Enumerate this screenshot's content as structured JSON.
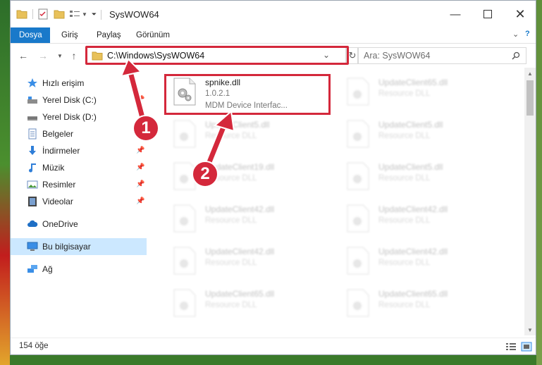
{
  "window": {
    "title": "SysWOW64"
  },
  "ribbon": {
    "tabs": [
      "Dosya",
      "Giriş",
      "Paylaş",
      "Görünüm"
    ]
  },
  "address": {
    "path": "C:\\Windows\\SysWOW64"
  },
  "search": {
    "placeholder": "Ara: SysWOW64"
  },
  "sidebar": {
    "items": [
      {
        "label": "Hızlı erişim",
        "icon": "star-icon"
      },
      {
        "label": "Yerel Disk (C:)",
        "icon": "drive-icon"
      },
      {
        "label": "Yerel Disk (D:)",
        "icon": "drive-icon"
      },
      {
        "label": "Belgeler",
        "icon": "document-icon"
      },
      {
        "label": "İndirmeler",
        "icon": "download-icon"
      },
      {
        "label": "Müzik",
        "icon": "music-icon"
      },
      {
        "label": "Resimler",
        "icon": "pictures-icon"
      },
      {
        "label": "Videolar",
        "icon": "video-icon"
      },
      {
        "label": "OneDrive",
        "icon": "cloud-icon"
      },
      {
        "label": "Bu bilgisayar",
        "icon": "computer-icon"
      },
      {
        "label": "Ağ",
        "icon": "network-icon"
      }
    ]
  },
  "files": {
    "highlighted": {
      "name": "spnike.dll",
      "version": "1.0.2.1",
      "desc": "MDM Device Interfac..."
    },
    "items": [
      {
        "name": "UpdateClient65.dll",
        "desc": "Resource DLL"
      },
      {
        "name": "UpdateClient5.dll",
        "desc": "Resource DLL"
      },
      {
        "name": "UpdateClient5.dll",
        "desc": "Resource DLL"
      },
      {
        "name": "UpdateClient19.dll",
        "desc": "Resource DLL"
      },
      {
        "name": "UpdateClient5.dll",
        "desc": "Resource DLL"
      },
      {
        "name": "UpdateClient42.dll",
        "desc": "Resource DLL"
      },
      {
        "name": "UpdateClient42.dll",
        "desc": "Resource DLL"
      },
      {
        "name": "UpdateClient42.dll",
        "desc": "Resource DLL"
      },
      {
        "name": "UpdateClient42.dll",
        "desc": "Resource DLL"
      },
      {
        "name": "UpdateClient65.dll",
        "desc": "Resource DLL"
      },
      {
        "name": "UpdateClient65.dll",
        "desc": "Resource DLL"
      }
    ]
  },
  "status": {
    "count": "154 öğe"
  },
  "annotations": {
    "step1": "1",
    "step2": "2"
  },
  "colors": {
    "accent": "#1979ca",
    "highlight": "#d4283b",
    "selection": "#cce8ff"
  }
}
